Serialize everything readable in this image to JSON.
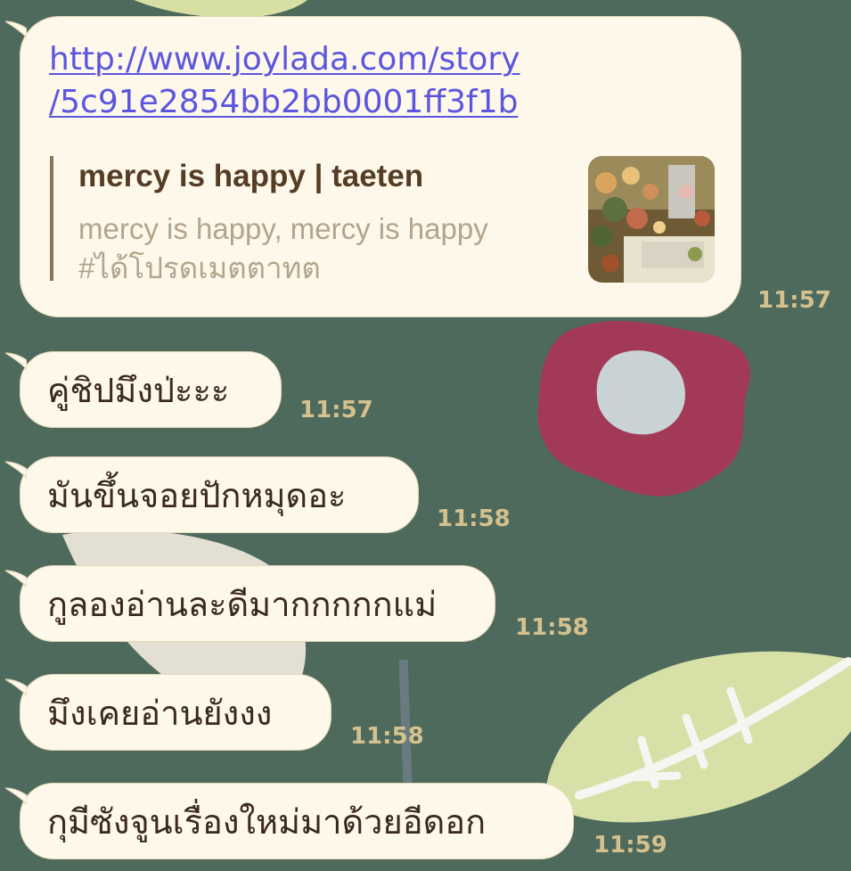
{
  "chat": {
    "messages": [
      {
        "type": "link",
        "url_line1": "http://www.joylada.com/story",
        "url_line2": "/5c91e2854bb2bb0001ff3f1b",
        "preview_title": "mercy is happy | taeten",
        "preview_desc_line1": "mercy is happy, mercy is happy",
        "preview_desc_line2": "#ได้โปรดเมตตาทต",
        "thumbnail": "flower-photo-thumbnail",
        "time": "11:57"
      },
      {
        "type": "text",
        "text": "คู่ชิปมึงป่ะะะ",
        "time": "11:57"
      },
      {
        "type": "text",
        "text": "มันขึ้นจอยปักหมุดอะ",
        "time": "11:58"
      },
      {
        "type": "text",
        "text": "กูลองอ่านละดีมากกกกกแม่",
        "time": "11:58"
      },
      {
        "type": "text",
        "text": "มึงเคยอ่านยังงง",
        "time": "11:58"
      },
      {
        "type": "text",
        "text": "กุมีซังจูนเรื่องใหม่มาด้วยอีดอก",
        "time": "11:59"
      }
    ]
  },
  "colors": {
    "wallpaper": "#4e6a5c",
    "bubble": "#fdf8ea",
    "bubble_border": "#e2d7b8",
    "link": "#5b55e0",
    "timestamp": "#d4c18e"
  }
}
